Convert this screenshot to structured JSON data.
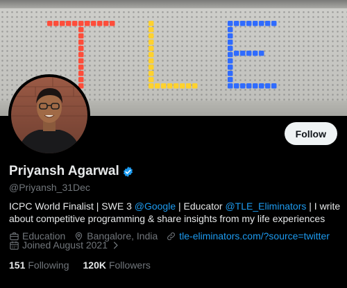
{
  "banner": {
    "letters": [
      "T",
      "L",
      "E"
    ],
    "letter_colors": {
      "t": "#ff4d3a",
      "l": "#ffd22e",
      "e": "#2f6bff"
    }
  },
  "profile": {
    "display_name": "Priyansh Agarwal",
    "handle": "@Priyansh_31Dec",
    "verified": true,
    "bio": {
      "part1": "ICPC World Finalist | SWE 3 ",
      "mention1": "@Google",
      "part2": " | Educator ",
      "mention2": "@TLE_Eliminators",
      "part3": " | I write about competitive programming & share insights from my life experiences"
    },
    "category": "Education",
    "location": "Bangalore, India",
    "website": "tle-eliminators.com/?source=twitter",
    "joined": "Joined August 2021",
    "following_count": "151",
    "following_label": "Following",
    "followers_count": "120K",
    "followers_label": "Followers"
  },
  "actions": {
    "follow_label": "Follow"
  },
  "colors": {
    "accent": "#1d9bf0",
    "secondary_text": "#71767b",
    "background": "#000000"
  },
  "icons": [
    "verified-badge-icon",
    "briefcase-icon",
    "location-pin-icon",
    "link-icon",
    "calendar-icon",
    "chevron-right-icon"
  ]
}
